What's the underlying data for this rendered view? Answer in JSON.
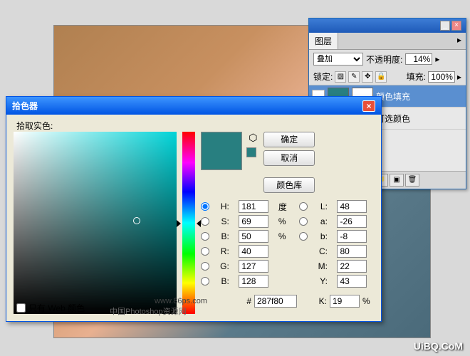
{
  "layersPanel": {
    "tabLabel": "图层",
    "blendMode": "叠加",
    "opacityLabel": "不透明度:",
    "opacityValue": "14%",
    "lockLabel": "锁定:",
    "fillLabel": "填充:",
    "fillValue": "100%",
    "layers": [
      {
        "name": "颜色填充",
        "color": "#287f80",
        "selected": true
      },
      {
        "name": "可选颜色",
        "color": "#e0e0e0",
        "selected": false
      }
    ]
  },
  "picker": {
    "title": "拾色器",
    "pickLabel": "拾取实色:",
    "buttons": {
      "ok": "确定",
      "cancel": "取消",
      "library": "颜色库"
    },
    "hsb": {
      "h": "181",
      "hUnit": "度",
      "s": "69",
      "sUnit": "%",
      "b": "50",
      "bUnit": "%"
    },
    "lab": {
      "l": "48",
      "a": "-26",
      "bb": "-8"
    },
    "rgb": {
      "r": "40",
      "g": "127",
      "b": "128"
    },
    "cmyk": {
      "c": "80",
      "cUnit": "%",
      "m": "22",
      "mUnit": "%",
      "y": "43",
      "yUnit": "%",
      "k": "19",
      "kUnit": "%"
    },
    "hex": "287f80",
    "webOnly": "只有 Web 颜色",
    "swatchColor": "#287f80"
  },
  "watermark": {
    "url": "www.86ps.com",
    "text": "中国Photoshop资源网",
    "brand": "UiBQ.CoM"
  }
}
